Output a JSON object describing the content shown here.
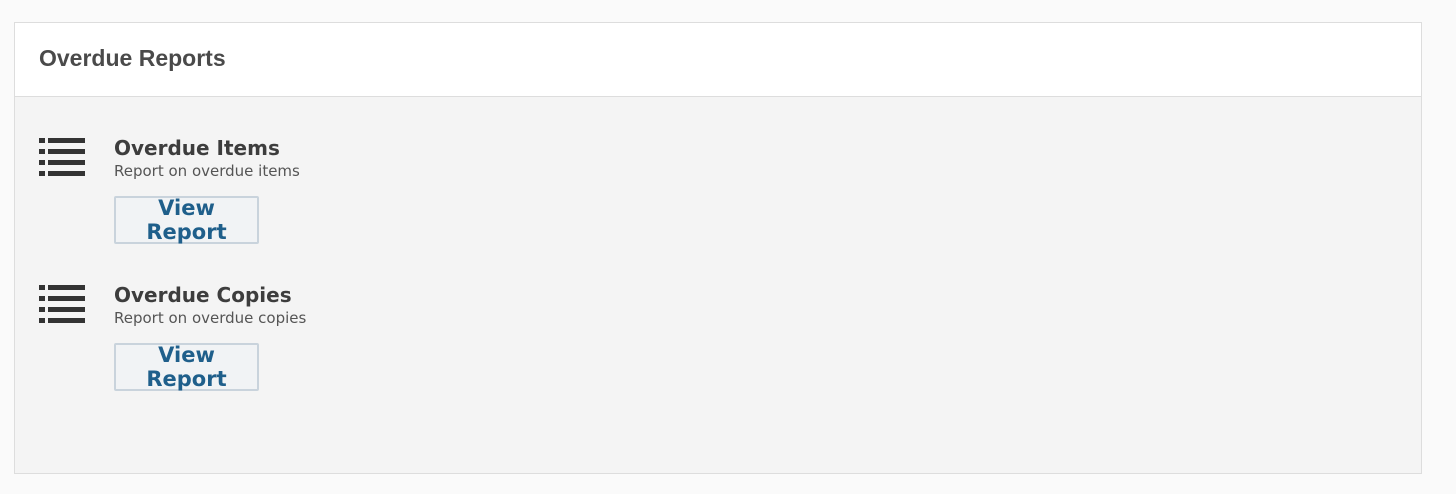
{
  "panel": {
    "title": "Overdue Reports"
  },
  "reports": [
    {
      "title": "Overdue Items",
      "description": "Report on overdue items",
      "button_label": "View Report",
      "icon": "list-icon"
    },
    {
      "title": "Overdue Copies",
      "description": "Report on overdue copies",
      "button_label": "View Report",
      "icon": "list-icon"
    }
  ],
  "colors": {
    "link": "#1f5f8b",
    "icon": "#333333",
    "panel_bg": "#f4f4f4",
    "header_bg": "#ffffff"
  }
}
